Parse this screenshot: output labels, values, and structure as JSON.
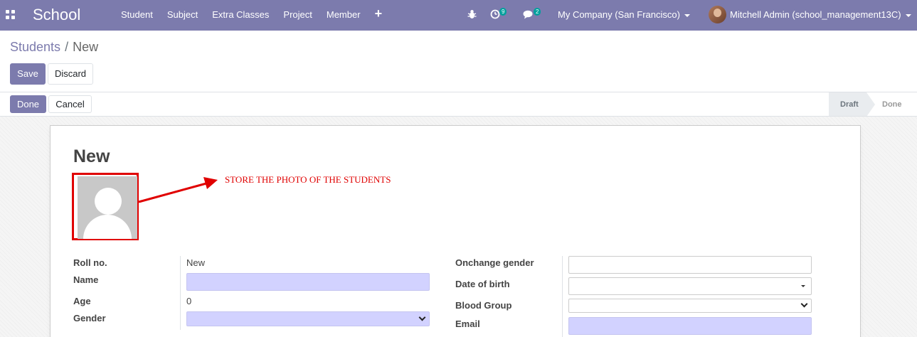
{
  "navbar": {
    "brand": "School",
    "menu": [
      "Student",
      "Subject",
      "Extra Classes",
      "Project",
      "Member"
    ],
    "activity_count": "9",
    "message_count": "2",
    "company": "My Company (San Francisco)",
    "user": "Mitchell Admin (school_management13C)",
    "color": "#7c7bad"
  },
  "breadcrumb": {
    "parent": "Students",
    "separator": "/",
    "current": "New"
  },
  "control": {
    "save_label": "Save",
    "discard_label": "Discard"
  },
  "statusbar": {
    "done_label": "Done",
    "cancel_label": "Cancel",
    "steps": [
      "Draft",
      "Done"
    ],
    "current_step": "Draft"
  },
  "form": {
    "title": "New",
    "annotation": "STORE THE PHOTO OF THE STUDENTS",
    "left": {
      "roll_label": "Roll no.",
      "roll_value": "New",
      "name_label": "Name",
      "name_value": "",
      "age_label": "Age",
      "age_value": "0",
      "gender_label": "Gender",
      "gender_value": ""
    },
    "right": {
      "onchange_gender_label": "Onchange gender",
      "dob_label": "Date of birth",
      "blood_label": "Blood Group",
      "email_label": "Email"
    }
  }
}
